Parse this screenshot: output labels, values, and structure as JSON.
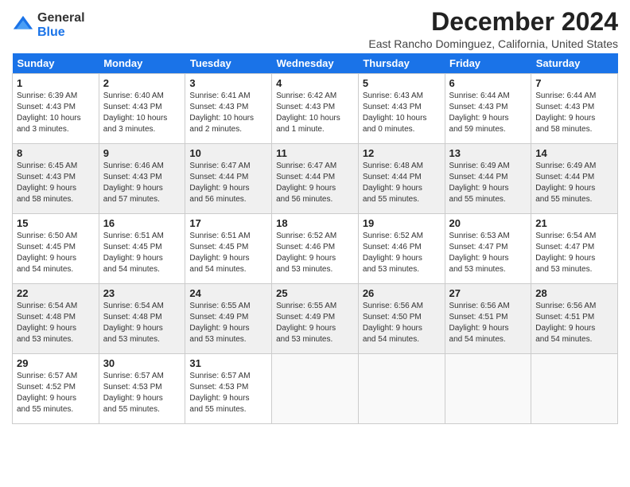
{
  "header": {
    "logo_general": "General",
    "logo_blue": "Blue",
    "title": "December 2024",
    "subtitle": "East Rancho Dominguez, California, United States"
  },
  "days_of_week": [
    "Sunday",
    "Monday",
    "Tuesday",
    "Wednesday",
    "Thursday",
    "Friday",
    "Saturday"
  ],
  "weeks": [
    [
      {
        "day": "1",
        "sunrise": "Sunrise: 6:39 AM",
        "sunset": "Sunset: 4:43 PM",
        "daylight": "Daylight: 10 hours",
        "extra": "and 3 minutes."
      },
      {
        "day": "2",
        "sunrise": "Sunrise: 6:40 AM",
        "sunset": "Sunset: 4:43 PM",
        "daylight": "Daylight: 10 hours",
        "extra": "and 3 minutes."
      },
      {
        "day": "3",
        "sunrise": "Sunrise: 6:41 AM",
        "sunset": "Sunset: 4:43 PM",
        "daylight": "Daylight: 10 hours",
        "extra": "and 2 minutes."
      },
      {
        "day": "4",
        "sunrise": "Sunrise: 6:42 AM",
        "sunset": "Sunset: 4:43 PM",
        "daylight": "Daylight: 10 hours",
        "extra": "and 1 minute."
      },
      {
        "day": "5",
        "sunrise": "Sunrise: 6:43 AM",
        "sunset": "Sunset: 4:43 PM",
        "daylight": "Daylight: 10 hours",
        "extra": "and 0 minutes."
      },
      {
        "day": "6",
        "sunrise": "Sunrise: 6:44 AM",
        "sunset": "Sunset: 4:43 PM",
        "daylight": "Daylight: 9 hours",
        "extra": "and 59 minutes."
      },
      {
        "day": "7",
        "sunrise": "Sunrise: 6:44 AM",
        "sunset": "Sunset: 4:43 PM",
        "daylight": "Daylight: 9 hours",
        "extra": "and 58 minutes."
      }
    ],
    [
      {
        "day": "8",
        "sunrise": "Sunrise: 6:45 AM",
        "sunset": "Sunset: 4:43 PM",
        "daylight": "Daylight: 9 hours",
        "extra": "and 58 minutes."
      },
      {
        "day": "9",
        "sunrise": "Sunrise: 6:46 AM",
        "sunset": "Sunset: 4:43 PM",
        "daylight": "Daylight: 9 hours",
        "extra": "and 57 minutes."
      },
      {
        "day": "10",
        "sunrise": "Sunrise: 6:47 AM",
        "sunset": "Sunset: 4:44 PM",
        "daylight": "Daylight: 9 hours",
        "extra": "and 56 minutes."
      },
      {
        "day": "11",
        "sunrise": "Sunrise: 6:47 AM",
        "sunset": "Sunset: 4:44 PM",
        "daylight": "Daylight: 9 hours",
        "extra": "and 56 minutes."
      },
      {
        "day": "12",
        "sunrise": "Sunrise: 6:48 AM",
        "sunset": "Sunset: 4:44 PM",
        "daylight": "Daylight: 9 hours",
        "extra": "and 55 minutes."
      },
      {
        "day": "13",
        "sunrise": "Sunrise: 6:49 AM",
        "sunset": "Sunset: 4:44 PM",
        "daylight": "Daylight: 9 hours",
        "extra": "and 55 minutes."
      },
      {
        "day": "14",
        "sunrise": "Sunrise: 6:49 AM",
        "sunset": "Sunset: 4:44 PM",
        "daylight": "Daylight: 9 hours",
        "extra": "and 55 minutes."
      }
    ],
    [
      {
        "day": "15",
        "sunrise": "Sunrise: 6:50 AM",
        "sunset": "Sunset: 4:45 PM",
        "daylight": "Daylight: 9 hours",
        "extra": "and 54 minutes."
      },
      {
        "day": "16",
        "sunrise": "Sunrise: 6:51 AM",
        "sunset": "Sunset: 4:45 PM",
        "daylight": "Daylight: 9 hours",
        "extra": "and 54 minutes."
      },
      {
        "day": "17",
        "sunrise": "Sunrise: 6:51 AM",
        "sunset": "Sunset: 4:45 PM",
        "daylight": "Daylight: 9 hours",
        "extra": "and 54 minutes."
      },
      {
        "day": "18",
        "sunrise": "Sunrise: 6:52 AM",
        "sunset": "Sunset: 4:46 PM",
        "daylight": "Daylight: 9 hours",
        "extra": "and 53 minutes."
      },
      {
        "day": "19",
        "sunrise": "Sunrise: 6:52 AM",
        "sunset": "Sunset: 4:46 PM",
        "daylight": "Daylight: 9 hours",
        "extra": "and 53 minutes."
      },
      {
        "day": "20",
        "sunrise": "Sunrise: 6:53 AM",
        "sunset": "Sunset: 4:47 PM",
        "daylight": "Daylight: 9 hours",
        "extra": "and 53 minutes."
      },
      {
        "day": "21",
        "sunrise": "Sunrise: 6:54 AM",
        "sunset": "Sunset: 4:47 PM",
        "daylight": "Daylight: 9 hours",
        "extra": "and 53 minutes."
      }
    ],
    [
      {
        "day": "22",
        "sunrise": "Sunrise: 6:54 AM",
        "sunset": "Sunset: 4:48 PM",
        "daylight": "Daylight: 9 hours",
        "extra": "and 53 minutes."
      },
      {
        "day": "23",
        "sunrise": "Sunrise: 6:54 AM",
        "sunset": "Sunset: 4:48 PM",
        "daylight": "Daylight: 9 hours",
        "extra": "and 53 minutes."
      },
      {
        "day": "24",
        "sunrise": "Sunrise: 6:55 AM",
        "sunset": "Sunset: 4:49 PM",
        "daylight": "Daylight: 9 hours",
        "extra": "and 53 minutes."
      },
      {
        "day": "25",
        "sunrise": "Sunrise: 6:55 AM",
        "sunset": "Sunset: 4:49 PM",
        "daylight": "Daylight: 9 hours",
        "extra": "and 53 minutes."
      },
      {
        "day": "26",
        "sunrise": "Sunrise: 6:56 AM",
        "sunset": "Sunset: 4:50 PM",
        "daylight": "Daylight: 9 hours",
        "extra": "and 54 minutes."
      },
      {
        "day": "27",
        "sunrise": "Sunrise: 6:56 AM",
        "sunset": "Sunset: 4:51 PM",
        "daylight": "Daylight: 9 hours",
        "extra": "and 54 minutes."
      },
      {
        "day": "28",
        "sunrise": "Sunrise: 6:56 AM",
        "sunset": "Sunset: 4:51 PM",
        "daylight": "Daylight: 9 hours",
        "extra": "and 54 minutes."
      }
    ],
    [
      {
        "day": "29",
        "sunrise": "Sunrise: 6:57 AM",
        "sunset": "Sunset: 4:52 PM",
        "daylight": "Daylight: 9 hours",
        "extra": "and 55 minutes."
      },
      {
        "day": "30",
        "sunrise": "Sunrise: 6:57 AM",
        "sunset": "Sunset: 4:53 PM",
        "daylight": "Daylight: 9 hours",
        "extra": "and 55 minutes."
      },
      {
        "day": "31",
        "sunrise": "Sunrise: 6:57 AM",
        "sunset": "Sunset: 4:53 PM",
        "daylight": "Daylight: 9 hours",
        "extra": "and 55 minutes."
      },
      null,
      null,
      null,
      null
    ]
  ]
}
